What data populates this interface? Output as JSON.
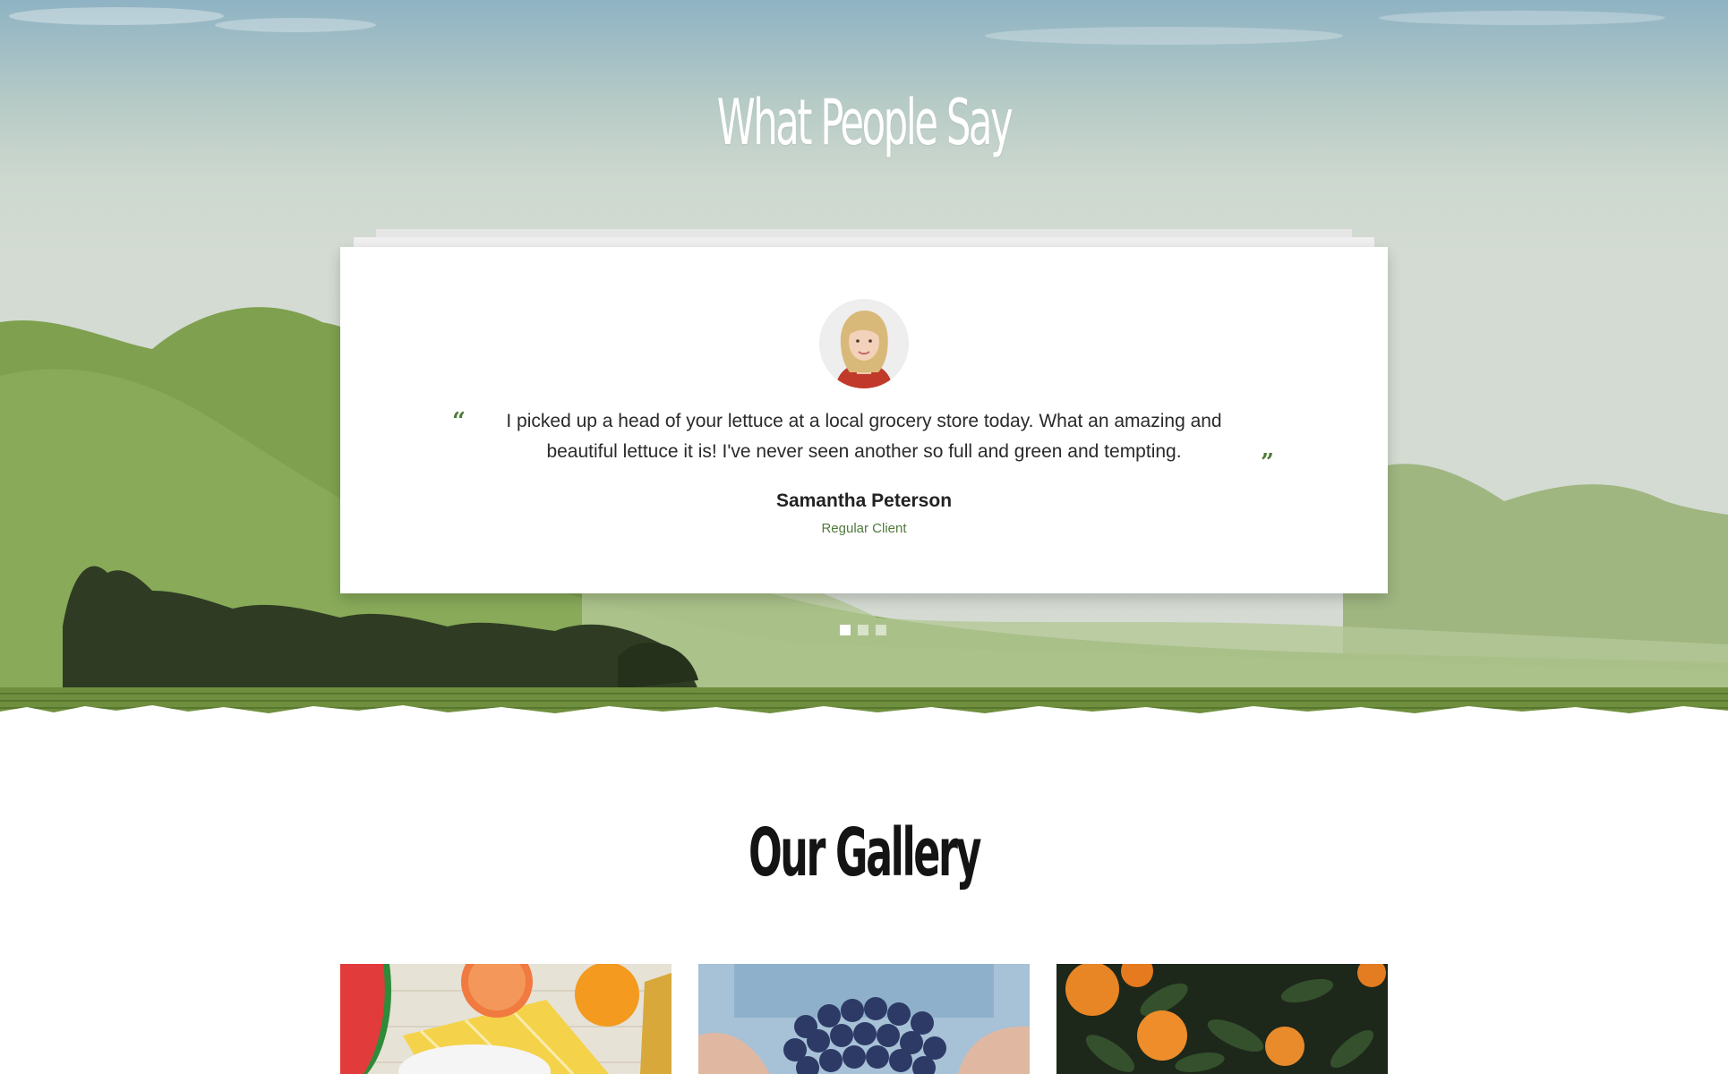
{
  "testimonials": {
    "title": "What People Say",
    "quote_open": "“",
    "quote_close": "”",
    "quote": "I picked up a head of your lettuce at a local grocery store today. What an amazing and beautiful lettuce it is! I've never seen another so full and green and tempting.",
    "client_name": "Samantha Peterson",
    "client_role": "Regular Client",
    "slides_total": 3,
    "active_slide": 1,
    "accent_color": "#4f7a3a"
  },
  "gallery": {
    "title": "Our Gallery",
    "items": [
      {
        "subject": "fruit-picnic-image"
      },
      {
        "subject": "blueberries-in-hands-image"
      },
      {
        "subject": "orange-tree-image"
      }
    ]
  }
}
